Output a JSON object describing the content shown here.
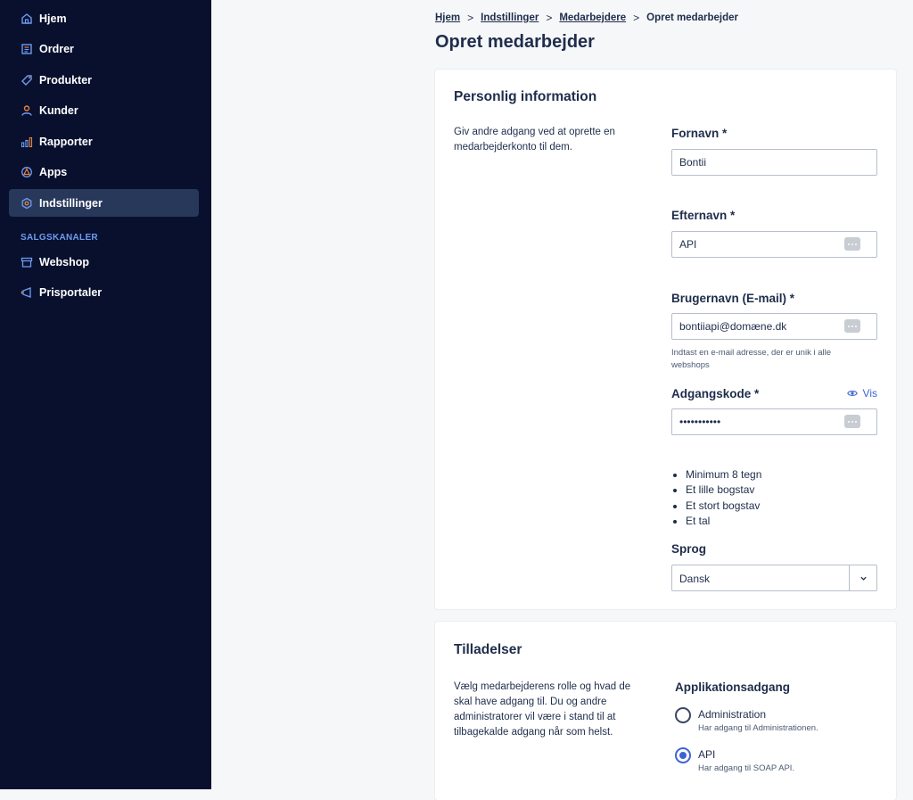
{
  "sidebar": {
    "items": [
      {
        "label": "Hjem",
        "icon": "home-icon"
      },
      {
        "label": "Ordrer",
        "icon": "orders-icon"
      },
      {
        "label": "Produkter",
        "icon": "tag-icon"
      },
      {
        "label": "Kunder",
        "icon": "user-icon"
      },
      {
        "label": "Rapporter",
        "icon": "bar-chart-icon"
      },
      {
        "label": "Apps",
        "icon": "apps-icon"
      },
      {
        "label": "Indstillinger",
        "icon": "gear-icon",
        "active": true
      }
    ],
    "section_title": "SALGSKANALER",
    "channels": [
      {
        "label": "Webshop",
        "icon": "store-icon"
      },
      {
        "label": "Prisportaler",
        "icon": "megaphone-icon"
      }
    ]
  },
  "breadcrumb": {
    "items": [
      "Hjem",
      "Indstillinger",
      "Medarbejdere"
    ],
    "current": "Opret medarbejder",
    "separator": ">"
  },
  "page_title": "Opret medarbejder",
  "personal": {
    "title": "Personlig information",
    "description": "Giv andre adgang ved at oprette en medarbejderkonto til dem.",
    "first_name": {
      "label": "Fornavn *",
      "value": "Bontii"
    },
    "last_name": {
      "label": "Efternavn *",
      "value": "API"
    },
    "username": {
      "label": "Brugernavn (E-mail) *",
      "value": "bontiiapi@domæne.dk",
      "help": "Indtast en e-mail adresse, der er unik i alle webshops"
    },
    "password": {
      "label": "Adgangskode *",
      "value": "***********",
      "show_label": "Vis"
    },
    "requirements": [
      "Minimum 8 tegn",
      "Et lille bogstav",
      "Et stort bogstav",
      "Et tal"
    ],
    "language": {
      "label": "Sprog",
      "value": "Dansk"
    }
  },
  "permissions": {
    "title": "Tilladelser",
    "description": "Vælg medarbejderens rolle og hvad de skal have adgang til. Du og andre administratorer vil være i stand til at tilbagekalde adgang når som helst.",
    "access_title": "Applikationsadgang",
    "options": [
      {
        "label": "Administration",
        "desc": "Har adgang til Administrationen.",
        "checked": false
      },
      {
        "label": "API",
        "desc": "Har adgang til SOAP API.",
        "checked": true
      }
    ]
  },
  "colors": {
    "sidebar_bg": "#08102e",
    "active_item_bg": "#28385b",
    "accent": "#3e64cf",
    "text": "#1f2d4b",
    "section_label": "#6f9bef"
  }
}
